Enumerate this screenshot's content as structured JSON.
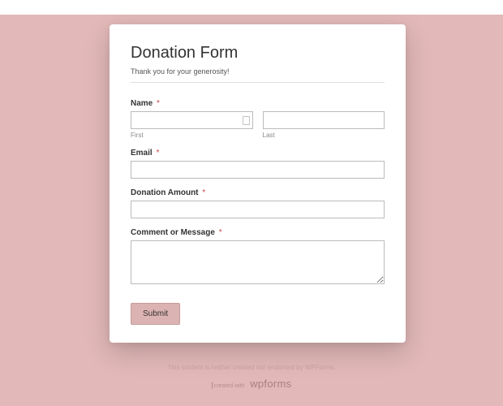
{
  "form": {
    "title": "Donation Form",
    "subtitle": "Thank you for your generosity!",
    "fields": {
      "name": {
        "label": "Name",
        "required": "*",
        "first_value": "",
        "last_value": "",
        "first_sublabel": "First",
        "last_sublabel": "Last"
      },
      "email": {
        "label": "Email",
        "required": "*",
        "value": ""
      },
      "amount": {
        "label": "Donation Amount",
        "required": "*",
        "value": ""
      },
      "comment": {
        "label": "Comment or Message",
        "required": "*",
        "value": ""
      }
    },
    "submit_label": "Submit"
  },
  "footer": {
    "disclaimer": "This content is neither created nor endorsed by WPForms.",
    "brand_prefix": "created with",
    "brand_name": "wpforms"
  }
}
